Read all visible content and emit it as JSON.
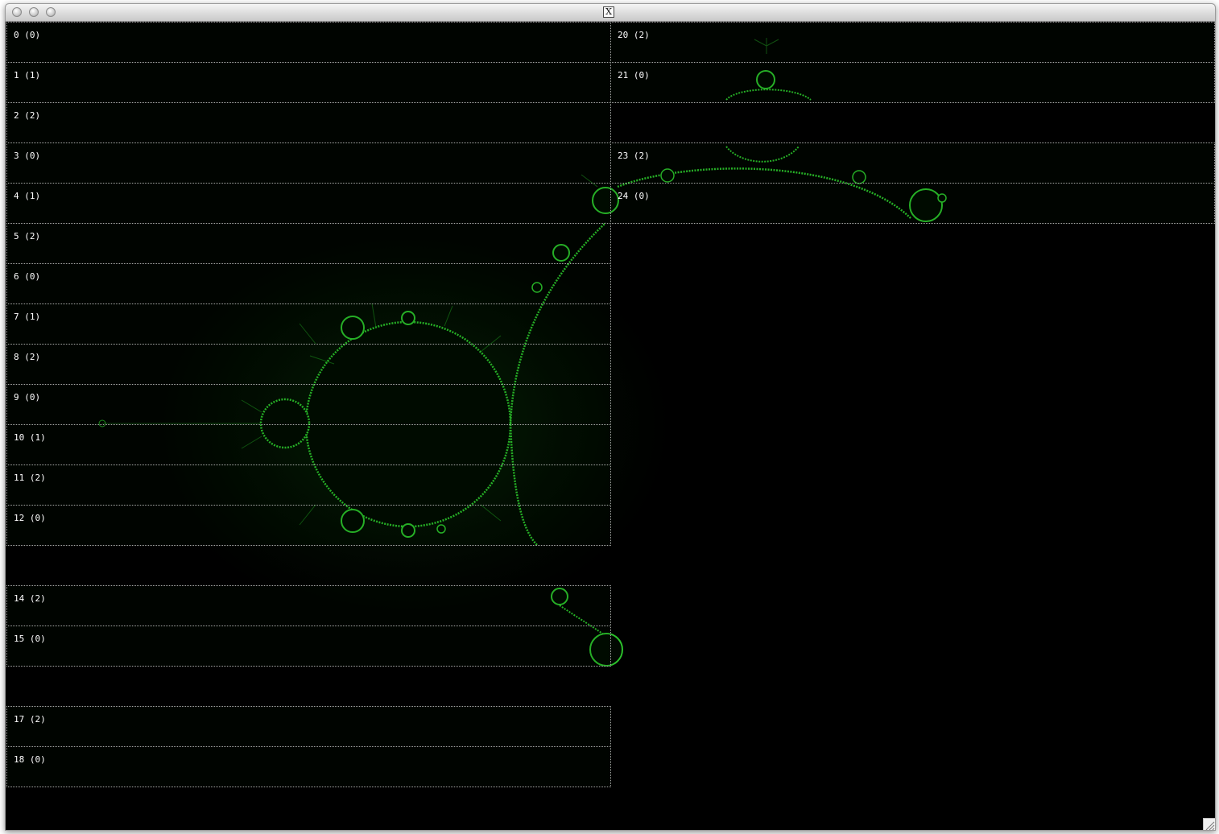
{
  "window": {
    "title_icon": "X",
    "controls": [
      "close-button",
      "minimize-button",
      "zoom-button"
    ]
  },
  "theme": {
    "background": "#000000",
    "fractal_color": "#22c422",
    "tile_border": "#a8a8a8",
    "label_color": "#ffffff"
  },
  "tiles": [
    {
      "id": 0,
      "label": "0 (0)"
    },
    {
      "id": 1,
      "label": "1 (1)"
    },
    {
      "id": 2,
      "label": "2 (2)"
    },
    {
      "id": 3,
      "label": "3 (0)"
    },
    {
      "id": 4,
      "label": "4 (1)"
    },
    {
      "id": 5,
      "label": "5 (2)"
    },
    {
      "id": 6,
      "label": "6 (0)"
    },
    {
      "id": 7,
      "label": "7 (1)"
    },
    {
      "id": 8,
      "label": "8 (2)"
    },
    {
      "id": 9,
      "label": "9 (0)"
    },
    {
      "id": 10,
      "label": "10 (1)"
    },
    {
      "id": 11,
      "label": "11 (2)"
    },
    {
      "id": 12,
      "label": "12 (0)"
    },
    {
      "id": 14,
      "label": "14 (2)"
    },
    {
      "id": 15,
      "label": "15 (0)"
    },
    {
      "id": 17,
      "label": "17 (2)"
    },
    {
      "id": 18,
      "label": "18 (0)"
    },
    {
      "id": 20,
      "label": "20 (2)"
    },
    {
      "id": 21,
      "label": "21 (0)"
    },
    {
      "id": 23,
      "label": "23 (2)"
    },
    {
      "id": 24,
      "label": "24 (0)"
    }
  ]
}
